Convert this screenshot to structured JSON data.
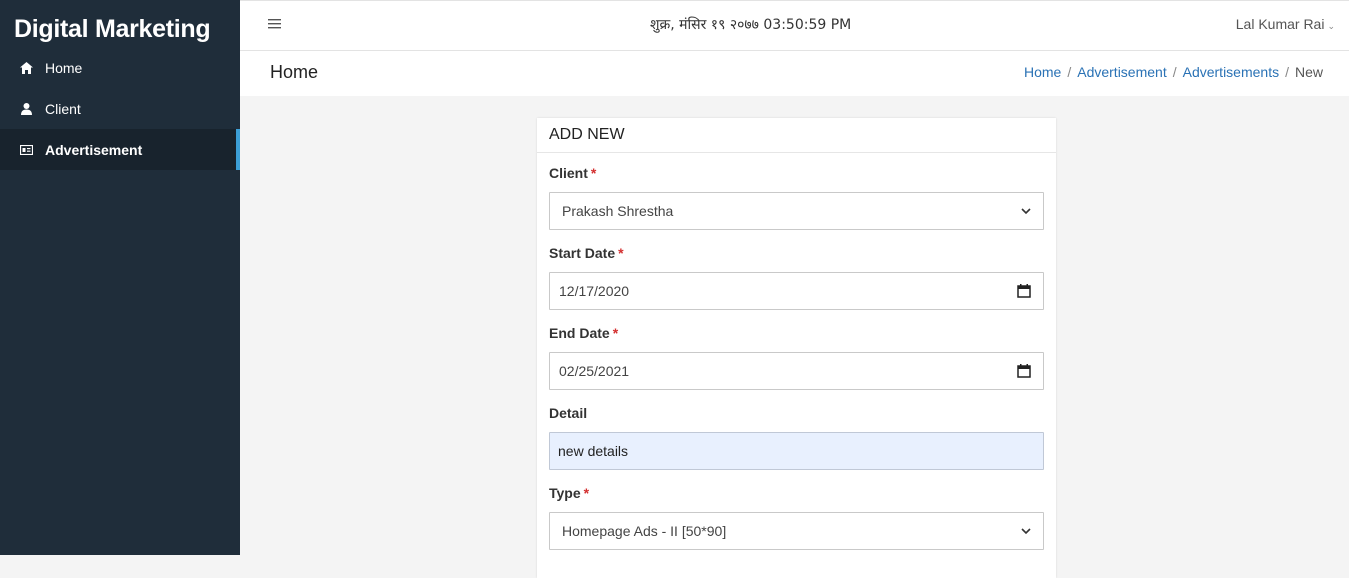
{
  "sidebar": {
    "brand": "Digital Marketing",
    "items": [
      {
        "label": "Home",
        "icon": "home-icon"
      },
      {
        "label": "Client",
        "icon": "user-icon"
      },
      {
        "label": "Advertisement",
        "icon": "ad-icon",
        "active": true
      }
    ]
  },
  "topbar": {
    "datetime": "शुक्र, मंसिर १९ २०७७ 03:50:59 PM",
    "user": "Lal Kumar Rai"
  },
  "page": {
    "title": "Home",
    "breadcrumb": [
      "Home",
      "Advertisement",
      "Advertisements",
      "New"
    ]
  },
  "form": {
    "header": "ADD NEW",
    "required_mark": "*",
    "client": {
      "label": "Client",
      "value": "Prakash Shrestha"
    },
    "start_date": {
      "label": "Start Date",
      "value": "12/17/2020"
    },
    "end_date": {
      "label": "End Date",
      "value": "02/25/2021"
    },
    "detail": {
      "label": "Detail",
      "value": "new details"
    },
    "type": {
      "label": "Type",
      "value": "Homepage Ads - II [50*90]"
    }
  },
  "colors": {
    "sidebar_bg": "#1f2d3a",
    "sidebar_active_bg": "#18232d",
    "active_indicator": "#3c9fd6",
    "link": "#2a72b5",
    "required": "#d32f2f",
    "autofill_bg": "#e8f0fe"
  }
}
